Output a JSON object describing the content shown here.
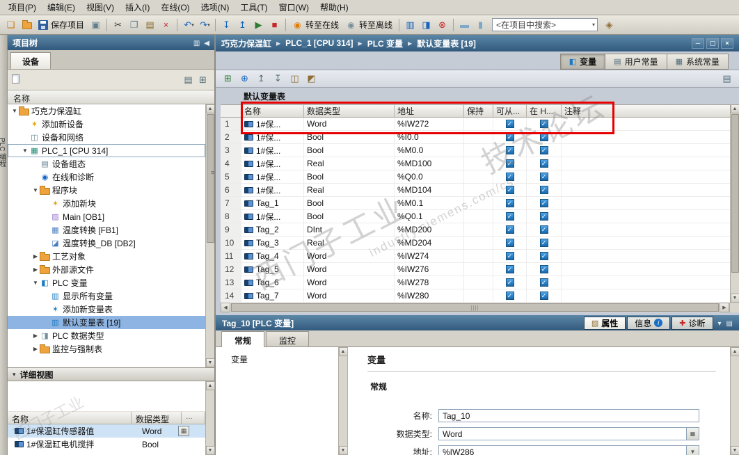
{
  "colors": {
    "caption_blue": "#31597d",
    "selection_blue": "#8db4e2",
    "check_blue": "#1767ae",
    "annotation_red": "#e60000"
  },
  "menubar": {
    "items": [
      "项目(P)",
      "编辑(E)",
      "视图(V)",
      "插入(I)",
      "在线(O)",
      "选项(N)",
      "工具(T)",
      "窗口(W)",
      "帮助(H)"
    ]
  },
  "toolbar": {
    "items": [
      {
        "t": "i",
        "name": "new-project-icon",
        "g": "❏",
        "c": "#c87a12"
      },
      {
        "t": "i",
        "name": "open-project-icon",
        "css": "ico-folder"
      },
      {
        "t": "btn",
        "name": "save-project-button",
        "css": "ico-floppy",
        "label": "保存项目"
      },
      {
        "t": "i",
        "name": "print-icon",
        "g": "▣",
        "c": "#607d8b"
      },
      {
        "t": "sep"
      },
      {
        "t": "i",
        "name": "cut-icon",
        "g": "✂",
        "c": "#333333"
      },
      {
        "t": "i",
        "name": "copy-icon",
        "g": "❐",
        "c": "#607d8b"
      },
      {
        "t": "i",
        "name": "paste-icon",
        "g": "▤",
        "c": "#8d6e34"
      },
      {
        "t": "i",
        "name": "delete-icon",
        "g": "×",
        "c": "#c62828"
      },
      {
        "t": "sep"
      },
      {
        "t": "i",
        "name": "undo-icon",
        "g": "↶",
        "c": "#1565c0",
        "drop": true
      },
      {
        "t": "i",
        "name": "redo-icon",
        "g": "↷",
        "c": "#1565c0",
        "drop": true
      },
      {
        "t": "sep"
      },
      {
        "t": "i",
        "name": "download-to-device-icon",
        "g": "↧",
        "c": "#1565c0"
      },
      {
        "t": "i",
        "name": "upload-from-device-icon",
        "g": "↥",
        "c": "#1565c0"
      },
      {
        "t": "i",
        "name": "start-cpu-icon",
        "g": "▶",
        "c": "#2e7d32"
      },
      {
        "t": "i",
        "name": "stop-cpu-icon",
        "g": "■",
        "c": "#c62828"
      },
      {
        "t": "sep"
      },
      {
        "t": "btn",
        "name": "go-online-button",
        "g": "◉",
        "c": "#e07b00",
        "label": "转至在线"
      },
      {
        "t": "btn",
        "name": "go-offline-button",
        "g": "◉",
        "c": "#78909c",
        "label": "转至离线"
      },
      {
        "t": "sep"
      },
      {
        "t": "i",
        "name": "accessible-devices-icon",
        "g": "▥",
        "c": "#1565c0"
      },
      {
        "t": "i",
        "name": "start-simulation-icon",
        "g": "◨",
        "c": "#1565c0"
      },
      {
        "t": "i",
        "name": "remove-connection-icon",
        "g": "⊗",
        "c": "#c62828"
      },
      {
        "t": "sep"
      },
      {
        "t": "i",
        "name": "split-editor-horizontal-icon",
        "g": "▬",
        "c": "#7da7c9"
      },
      {
        "t": "i",
        "name": "split-editor-vertical-icon",
        "g": "▮",
        "c": "#7da7c9"
      },
      {
        "t": "search",
        "name": "search-combobox",
        "value": "<在项目中搜索>"
      },
      {
        "t": "i",
        "name": "project-library-icon",
        "g": "◈",
        "c": "#8d6e34"
      }
    ]
  },
  "left_strip": {
    "label": "PLC 编程"
  },
  "icons": {
    "project": {
      "css": "ico-folder"
    },
    "add": {
      "g": "✶",
      "c": "#d9a400"
    },
    "net": {
      "g": "◫",
      "c": "#607d8b"
    },
    "plc": {
      "g": "▦",
      "c": "#1d8a74"
    },
    "cfg": {
      "g": "▤",
      "c": "#607d8b"
    },
    "diag": {
      "g": "◉",
      "c": "#1565c0"
    },
    "folder": {
      "css": "ico-folder"
    },
    "addb": {
      "g": "✶",
      "c": "#d9a400"
    },
    "ob": {
      "g": "▨",
      "c": "#9575cd"
    },
    "fb": {
      "g": "▦",
      "c": "#4a7dbf"
    },
    "db": {
      "g": "◪",
      "c": "#4a7dbf"
    },
    "tags": {
      "g": "◧",
      "c": "#1c7ac2"
    },
    "showtags": {
      "g": "▥",
      "c": "#1c7ac2"
    },
    "addtbl": {
      "g": "✶",
      "c": "#1c7ac2"
    },
    "tagtbl": {
      "g": "▥",
      "c": "#1c7ac2"
    },
    "types": {
      "g": "◨",
      "c": "#78909c"
    }
  },
  "ptree": {
    "title": "项目树",
    "tab": "设备",
    "colhdr": "名称",
    "header_icons": [
      {
        "name": "panel-pin-icon",
        "g": "▥"
      },
      {
        "name": "panel-collapse-icon",
        "g": "◀"
      }
    ],
    "mini_left": [
      {
        "name": "add-item-icon",
        "css": "ico-page"
      }
    ],
    "mini_right": [
      {
        "name": "details-toggle-icon",
        "g": "▤",
        "c": "#546e7a"
      },
      {
        "name": "column-options-icon",
        "g": "⊞",
        "c": "#546e7a"
      }
    ],
    "items": [
      {
        "lvl": 0,
        "arr": "e",
        "icon": "project",
        "label": "巧克力保温缸"
      },
      {
        "lvl": 1,
        "arr": "",
        "icon": "add",
        "label": "添加新设备"
      },
      {
        "lvl": 1,
        "arr": "",
        "icon": "net",
        "label": "设备和网络"
      },
      {
        "lvl": 1,
        "arr": "e",
        "icon": "plc",
        "label": "PLC_1 [CPU 314]",
        "framed": true
      },
      {
        "lvl": 2,
        "arr": "",
        "icon": "cfg",
        "label": "设备组态"
      },
      {
        "lvl": 2,
        "arr": "",
        "icon": "diag",
        "label": "在线和诊断"
      },
      {
        "lvl": 2,
        "arr": "e",
        "icon": "folder",
        "label": "程序块"
      },
      {
        "lvl": 3,
        "arr": "",
        "icon": "addb",
        "label": "添加新块"
      },
      {
        "lvl": 3,
        "arr": "",
        "icon": "ob",
        "label": "Main [OB1]"
      },
      {
        "lvl": 3,
        "arr": "",
        "icon": "fb",
        "label": "温度转换 [FB1]"
      },
      {
        "lvl": 3,
        "arr": "",
        "icon": "db",
        "label": "温度转换_DB [DB2]"
      },
      {
        "lvl": 2,
        "arr": "c",
        "icon": "folder",
        "label": "工艺对象"
      },
      {
        "lvl": 2,
        "arr": "c",
        "icon": "folder",
        "label": "外部源文件"
      },
      {
        "lvl": 2,
        "arr": "e",
        "icon": "tags",
        "label": "PLC 变量"
      },
      {
        "lvl": 3,
        "arr": "",
        "icon": "showtags",
        "label": "显示所有变量"
      },
      {
        "lvl": 3,
        "arr": "",
        "icon": "addtbl",
        "label": "添加新变量表"
      },
      {
        "lvl": 3,
        "arr": "",
        "icon": "tagtbl",
        "label": "默认变量表 [19]",
        "selected": true
      },
      {
        "lvl": 2,
        "arr": "c",
        "icon": "types",
        "label": "PLC 数据类型"
      },
      {
        "lvl": 2,
        "arr": "c",
        "icon": "folder",
        "label": "监控与强制表"
      }
    ]
  },
  "detail": {
    "title": "详细视图",
    "cols": [
      "名称",
      "数据类型"
    ],
    "more": "…",
    "rows": [
      {
        "name": "1#保温缸传感器值",
        "type": "Word",
        "selected": true,
        "btn": true
      },
      {
        "name": "1#保温缸电机搅拌",
        "type": "Bool"
      }
    ]
  },
  "breadcrumb": {
    "items": [
      "巧克力保温缸",
      "PLC_1 [CPU 314]",
      "PLC 变量",
      "默认变量表 [19]"
    ]
  },
  "window_controls": [
    {
      "name": "minimize-button",
      "g": "─"
    },
    {
      "name": "restore-button",
      "g": "▢"
    },
    {
      "name": "close-button",
      "g": "×"
    }
  ],
  "main": {
    "rtabs": [
      {
        "name": "tab-tags",
        "label": "变量",
        "g": "◧",
        "c": "#1c7ac2",
        "active": true
      },
      {
        "name": "tab-user-constants",
        "label": "用户常量",
        "g": "▤",
        "c": "#546e7a"
      },
      {
        "name": "tab-system-constants",
        "label": "系统常量",
        "g": "▦",
        "c": "#546e7a"
      }
    ],
    "tool_left": [
      {
        "name": "add-row-icon",
        "g": "⊞",
        "c": "#2e7d32"
      },
      {
        "name": "insert-row-icon",
        "g": "⊕",
        "c": "#1565c0"
      },
      {
        "name": "export-icon",
        "g": "↥",
        "c": "#546e7a"
      },
      {
        "name": "import-icon",
        "g": "↧",
        "c": "#546e7a"
      },
      {
        "name": "snapshot-icon",
        "g": "◫",
        "c": "#8d6e34"
      },
      {
        "name": "apply-snapshot-icon",
        "g": "◩",
        "c": "#8d6e34"
      }
    ],
    "tool_right": [
      {
        "name": "table-settings-icon",
        "g": "▤",
        "c": "#546e7a"
      }
    ],
    "table_title": "默认变量表",
    "table": {
      "cols": [
        {
          "label": "",
          "cls": "c-num"
        },
        {
          "label": "名称",
          "cls": "c-name"
        },
        {
          "label": "数据类型",
          "cls": "c-type"
        },
        {
          "label": "地址",
          "cls": "c-addr"
        },
        {
          "label": "保持",
          "cls": "c-ret"
        },
        {
          "label": "可从...",
          "cls": "c-acc"
        },
        {
          "label": "在 H...",
          "cls": "c-hmi"
        },
        {
          "label": "注释",
          "cls": "c-com"
        }
      ],
      "rows": [
        {
          "n": "1",
          "name": "1#保...",
          "type": "Word",
          "addr": "%IW272",
          "ret": false,
          "acc": true,
          "hmi": true
        },
        {
          "n": "2",
          "name": "1#保...",
          "type": "Bool",
          "addr": "%I0.0",
          "ret": false,
          "acc": true,
          "hmi": true
        },
        {
          "n": "3",
          "name": "1#保...",
          "type": "Bool",
          "addr": "%M0.0",
          "ret": false,
          "acc": true,
          "hmi": true
        },
        {
          "n": "4",
          "name": "1#保...",
          "type": "Real",
          "addr": "%MD100",
          "ret": false,
          "acc": true,
          "hmi": true
        },
        {
          "n": "5",
          "name": "1#保...",
          "type": "Bool",
          "addr": "%Q0.0",
          "ret": false,
          "acc": true,
          "hmi": true
        },
        {
          "n": "6",
          "name": "1#保...",
          "type": "Real",
          "addr": "%MD104",
          "ret": false,
          "acc": true,
          "hmi": true
        },
        {
          "n": "7",
          "name": "Tag_1",
          "type": "Bool",
          "addr": "%M0.1",
          "ret": false,
          "acc": true,
          "hmi": true
        },
        {
          "n": "8",
          "name": "1#保...",
          "type": "Bool",
          "addr": "%Q0.1",
          "ret": false,
          "acc": true,
          "hmi": true
        },
        {
          "n": "9",
          "name": "Tag_2",
          "type": "DInt",
          "addr": "%MD200",
          "ret": false,
          "acc": true,
          "hmi": true
        },
        {
          "n": "10",
          "name": "Tag_3",
          "type": "Real",
          "addr": "%MD204",
          "ret": false,
          "acc": true,
          "hmi": true
        },
        {
          "n": "11",
          "name": "Tag_4",
          "type": "Word",
          "addr": "%IW274",
          "ret": false,
          "acc": true,
          "hmi": true
        },
        {
          "n": "12",
          "name": "Tag_5",
          "type": "Word",
          "addr": "%IW276",
          "ret": false,
          "acc": true,
          "hmi": true
        },
        {
          "n": "13",
          "name": "Tag_6",
          "type": "Word",
          "addr": "%IW278",
          "ret": false,
          "acc": true,
          "hmi": true
        },
        {
          "n": "14",
          "name": "Tag_7",
          "type": "Word",
          "addr": "%IW280",
          "ret": false,
          "acc": true,
          "hmi": true
        }
      ]
    }
  },
  "props": {
    "title": "Tag_10 [PLC 变量]",
    "tabs": [
      {
        "name": "tab-properties",
        "label": "属性",
        "g": "▧",
        "c": "#8d6e34",
        "active": true
      },
      {
        "name": "tab-info",
        "label": "信息",
        "info": true
      },
      {
        "name": "tab-diagnostics",
        "label": "诊断",
        "g": "✚",
        "c": "#c62828"
      }
    ],
    "cap_icons": [
      {
        "name": "collapse-panel-icon",
        "g": "▾"
      },
      {
        "name": "panel-menu-icon",
        "g": "▤"
      }
    ],
    "subtabs": [
      {
        "name": "tab-general",
        "label": "常规",
        "active": true
      },
      {
        "name": "tab-monitor",
        "label": "监控",
        "active": false
      }
    ],
    "list_item": "变量",
    "form": {
      "section": "变量",
      "group": "常规",
      "fields": [
        {
          "name": "name-field",
          "label": "名称:",
          "value": "Tag_10",
          "btn": ""
        },
        {
          "name": "datatype-field",
          "label": "数据类型:",
          "value": "Word",
          "btn": "grid"
        },
        {
          "name": "address-field",
          "label": "地址:",
          "value": "%IW286",
          "btn": "dd"
        }
      ]
    }
  },
  "watermark": {
    "line1": "西门子工业",
    "line2": "技术论坛",
    "url": "industry.siemens.com/cs"
  }
}
